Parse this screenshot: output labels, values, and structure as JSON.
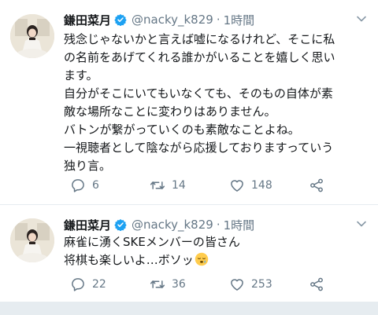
{
  "tweets": [
    {
      "author_name": "鎌田菜月",
      "verified": true,
      "handle": "@nacky_k829",
      "separator": "·",
      "time": "1時間",
      "lines": [
        "残念じゃないかと言えば嘘になるけれど、そこに私",
        "の名前をあげてくれる誰かがいることを嬉しく思い",
        "ます。",
        "自分がそこにいてもいなくても、そのもの自体が素",
        "敵な場所なことに変わりはありません。",
        "バトンが繋がっていくのも素敵なことよね。",
        "一視聴者として陰ながら応援しておりますっていう",
        "独り言。"
      ],
      "reply_count": "6",
      "retweet_count": "14",
      "like_count": "148"
    },
    {
      "author_name": "鎌田菜月",
      "verified": true,
      "handle": "@nacky_k829",
      "separator": "·",
      "time": "1時間",
      "lines": [
        "麻雀に湧くSKEメンバーの皆さん",
        "将棋も楽しいよ…ボソッ"
      ],
      "emoji_icon": "sleepy-face-emoji",
      "reply_count": "22",
      "retweet_count": "36",
      "like_count": "253"
    }
  ],
  "colors": {
    "text": "#14171a",
    "secondary": "#657786",
    "verified": "#1da1f2",
    "divider": "#e6ecf0"
  }
}
